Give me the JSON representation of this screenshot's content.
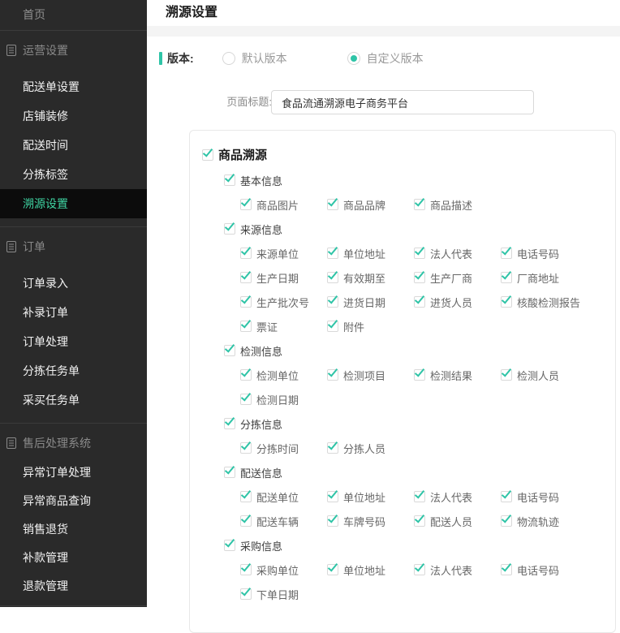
{
  "colors": {
    "accent": "#2fc4a7",
    "sidebar_active_text": "#3fd3a2",
    "sidebar_bg": "#2a2a2a"
  },
  "sidebar": {
    "home": "首页",
    "sections": [
      {
        "title": "运营设置",
        "items": [
          "配送单设置",
          "店铺装修",
          "配送时间",
          "分拣标签",
          "溯源设置"
        ],
        "active": "溯源设置"
      },
      {
        "title": "订单",
        "items": [
          "订单录入",
          "补录订单",
          "订单处理",
          "分拣任务单",
          "采买任务单"
        ]
      },
      {
        "title": "售后处理系统",
        "items": [
          "异常订单处理",
          "异常商品查询",
          "销售退货",
          "补款管理",
          "退款管理"
        ]
      }
    ]
  },
  "header": {
    "title": "溯源设置"
  },
  "version_row": {
    "label": "版本:",
    "options": [
      {
        "label": "默认版本",
        "selected": false
      },
      {
        "label": "自定义版本",
        "selected": true
      }
    ]
  },
  "page_title_field": {
    "label": "页面标题:",
    "value": "食品流通溯源电子商务平台"
  },
  "icons": {
    "section": "document-icon",
    "checkbox": "check-icon",
    "radio": "radio-dot"
  },
  "tree": {
    "root": {
      "label": "商品溯源",
      "checked": true
    },
    "groups": [
      {
        "label": "基本信息",
        "checked": true,
        "rows": [
          [
            "商品图片",
            "商品品牌",
            "商品描述"
          ]
        ]
      },
      {
        "label": "来源信息",
        "checked": true,
        "rows": [
          [
            "来源单位",
            "单位地址",
            "法人代表",
            "电话号码"
          ],
          [
            "生产日期",
            "有效期至",
            "生产厂商",
            "厂商地址"
          ],
          [
            "生产批次号",
            "进货日期",
            "进货人员",
            "核酸检测报告"
          ],
          [
            "票证",
            "附件"
          ]
        ]
      },
      {
        "label": "检测信息",
        "checked": true,
        "rows": [
          [
            "检测单位",
            "检测项目",
            "检测结果",
            "检测人员"
          ],
          [
            "检测日期"
          ]
        ]
      },
      {
        "label": "分拣信息",
        "checked": true,
        "rows": [
          [
            "分拣时间",
            "分拣人员"
          ]
        ]
      },
      {
        "label": "配送信息",
        "checked": true,
        "rows": [
          [
            "配送单位",
            "单位地址",
            "法人代表",
            "电话号码"
          ],
          [
            "配送车辆",
            "车牌号码",
            "配送人员",
            "物流轨迹"
          ]
        ]
      },
      {
        "label": "采购信息",
        "checked": true,
        "rows": [
          [
            "采购单位",
            "单位地址",
            "法人代表",
            "电话号码"
          ],
          [
            "下单日期"
          ]
        ]
      }
    ]
  }
}
